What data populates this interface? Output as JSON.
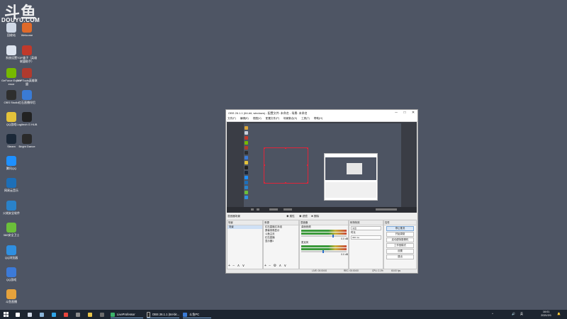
{
  "watermark": {
    "logo": "斗鱼",
    "site": "DOUYU.COM"
  },
  "desktop_icons": [
    {
      "label": "回收站",
      "color": "#cfd8e6"
    },
    {
      "label": "Welcome",
      "color": "#e06a2a"
    },
    {
      "label": "系统设置",
      "color": "#dde4ef"
    },
    {
      "label": "TGP盒子（英雄联盟助手）",
      "color": "#c0392b"
    },
    {
      "label": "GeForce Experience",
      "color": "#76b900"
    },
    {
      "label": "TGPTools英雄联盟",
      "color": "#b03a2e"
    },
    {
      "label": "OBS Studio",
      "color": "#2e2e2e"
    },
    {
      "label": "红石直播伴侣",
      "color": "#3a7bd5"
    },
    {
      "label": "QQ游戏",
      "color": "#e3c23a"
    },
    {
      "label": "Logitech G HUB",
      "color": "#222222"
    },
    {
      "label": "Steam",
      "color": "#1b2838"
    },
    {
      "label": "Bright Dance",
      "color": "#2a2a2a"
    },
    {
      "label": "腾讯QQ",
      "color": "#1e90ff"
    },
    {
      "label": "网易云音乐",
      "color": "#1d6fb8"
    },
    {
      "label": "火绒安全软件",
      "color": "#2a82c9"
    },
    {
      "label": "360安全卫士",
      "color": "#6bbf3a"
    },
    {
      "label": "QQ浏览器",
      "color": "#2f8fe0"
    },
    {
      "label": "QQ游戏",
      "color": "#3c7ad8"
    },
    {
      "label": "斗鱼直播",
      "color": "#e6a23c"
    }
  ],
  "obs": {
    "title": "OBS 26.1.1 (64-bit, windows) - 配置文件: 未命名 - 场景: 未命名",
    "window_buttons": [
      "─",
      "□",
      "✕"
    ],
    "menu": [
      "文件(F)",
      "编辑(E)",
      "视图(V)",
      "配置文件(P)",
      "场景集合(S)",
      "工具(T)",
      "帮助(H)"
    ],
    "preview_toolbar": {
      "dock_name": "混音器场景",
      "buttons": [
        "◉ 属性",
        "◉ 滤镜",
        "✖ 删除"
      ]
    },
    "scenes": {
      "header": "场景",
      "items": [
        "场景"
      ],
      "footer": "+ − ∧ ∨"
    },
    "sources": {
      "header": "来源",
      "items": [
        "红石直播文本组",
        "屏幕录像显示",
        "斗鱼主页",
        "红石直播",
        "显示器1"
      ],
      "footer": "+ − ⚙ ∧ ∨"
    },
    "mixer": {
      "header": "混音器",
      "tracks": [
        {
          "name": "桌面音频",
          "db": "0.0 dB"
        },
        {
          "name": "麦克风",
          "db": "0.0 dB"
        }
      ]
    },
    "transitions": {
      "header": "转场特效",
      "type": "淡出",
      "duration_label": "时长",
      "duration": "300 ms"
    },
    "controls": {
      "header": "控件",
      "buttons": [
        "停止推流",
        "开始录制",
        "启动虚拟摄像机",
        "工作室模式",
        "设置",
        "退出"
      ]
    },
    "status": {
      "fps": "60.00 fps",
      "live": "LIVE: 00:00:00",
      "rec": "REC: 00:00:00",
      "cpu": "CPU: 2.1%"
    }
  },
  "taskbar": {
    "pinned": [
      {
        "name": "search",
        "color": "#ffffff"
      },
      {
        "name": "task-view",
        "color": "#cfd8e6"
      },
      {
        "name": "steam",
        "color": "#8ab4d8"
      },
      {
        "name": "edge",
        "color": "#2fa4e7"
      },
      {
        "name": "chrome",
        "color": "#e8453c"
      },
      {
        "name": "app",
        "color": "#8a8a8a"
      },
      {
        "name": "explorer",
        "color": "#e6c24a"
      },
      {
        "name": "app2",
        "color": "#6c6c6c"
      }
    ],
    "windows": [
      {
        "title": "LiveProfessor",
        "color": "#3bb36b"
      },
      {
        "title": "OBS 26.1.1 (64-bit...",
        "color": "#2e2e2e"
      },
      {
        "title": "斗鱼PC",
        "color": "#3a7bd5"
      }
    ],
    "tray": [
      "^",
      "🔊",
      "英",
      "🔔"
    ],
    "time": "16:01",
    "date": "2021/2/1"
  }
}
